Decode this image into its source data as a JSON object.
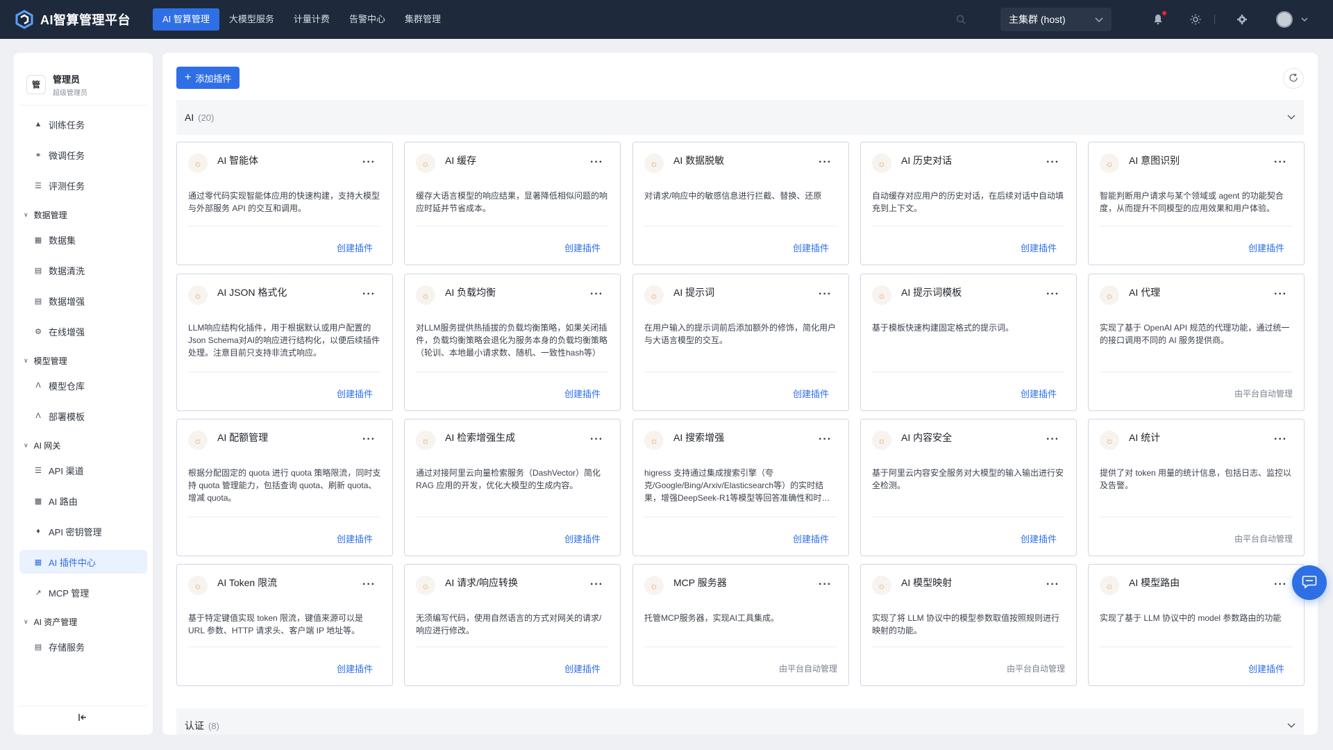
{
  "app": {
    "title": "AI智算管理平台"
  },
  "topnav": [
    {
      "label": "AI 智算管理",
      "active": true
    },
    {
      "label": "大模型服务",
      "active": false
    },
    {
      "label": "计量计费",
      "active": false
    },
    {
      "label": "告警中心",
      "active": false
    },
    {
      "label": "集群管理",
      "active": false
    }
  ],
  "cluster": {
    "selected": "主集群 (host)"
  },
  "user": {
    "avatar_text": "管",
    "name": "管理员",
    "role": "超级管理员"
  },
  "sidebar": {
    "top_items": [
      {
        "label": "训练任务",
        "icon": "training-icon"
      },
      {
        "label": "微调任务",
        "icon": "finetune-icon"
      },
      {
        "label": "评测任务",
        "icon": "evaluate-icon"
      }
    ],
    "groups": [
      {
        "label": "数据管理",
        "items": [
          {
            "label": "数据集",
            "icon": "dataset-icon"
          },
          {
            "label": "数据清洗",
            "icon": "clean-icon"
          },
          {
            "label": "数据增强",
            "icon": "augment-icon"
          },
          {
            "label": "在线增强",
            "icon": "online-augment-icon"
          }
        ]
      },
      {
        "label": "模型管理",
        "items": [
          {
            "label": "模型仓库",
            "icon": "model-repo-icon"
          },
          {
            "label": "部署模板",
            "icon": "deploy-template-icon"
          }
        ]
      },
      {
        "label": "AI 网关",
        "items": [
          {
            "label": "API 渠道",
            "icon": "api-channel-icon"
          },
          {
            "label": "AI 路由",
            "icon": "ai-route-icon"
          },
          {
            "label": "API 密钥管理",
            "icon": "key-icon"
          },
          {
            "label": "AI 插件中心",
            "icon": "plugin-icon",
            "active": true
          },
          {
            "label": "MCP 管理",
            "icon": "mcp-icon"
          }
        ]
      },
      {
        "label": "AI 资产管理",
        "items": [
          {
            "label": "存储服务",
            "icon": "storage-icon"
          }
        ]
      }
    ]
  },
  "main": {
    "add_button": "添加插件",
    "sections": [
      {
        "name": "AI",
        "count": "(20)"
      },
      {
        "name": "认证",
        "count": "(8)"
      }
    ],
    "create_label": "创建插件",
    "auto_label": "由平台自动管理",
    "plugins": [
      {
        "name": "AI 智能体",
        "desc": "通过零代码实现智能体应用的快速构建，支持大模型与外部服务 API 的交互和调用。",
        "auto": false
      },
      {
        "name": "AI 缓存",
        "desc": "缓存大语言模型的响应结果，显著降低相似问题的响应时延并节省成本。",
        "auto": false
      },
      {
        "name": "AI 数据脱敏",
        "desc": "对请求/响应中的敏感信息进行拦截、替换、还原",
        "auto": false
      },
      {
        "name": "AI 历史对话",
        "desc": "自动缓存对应用户的历史对话，在后续对话中自动填充到上下文。",
        "auto": false
      },
      {
        "name": "AI 意图识别",
        "desc": "智能判断用户请求与某个领域或 agent 的功能契合度，从而提升不同模型的应用效果和用户体验。",
        "auto": false
      },
      {
        "name": "AI JSON 格式化",
        "desc": "LLM响应结构化插件，用于根据默认或用户配置的Json Schema对AI的响应进行结构化，以便后续插件处理。注意目前只支持非流式响应。",
        "auto": false
      },
      {
        "name": "AI 负载均衡",
        "desc": "对LLM服务提供热插拔的负载均衡策略，如果关闭插件，负载均衡策略会退化为服务本身的负载均衡策略（轮训、本地最小请求数、随机、一致性hash等）",
        "auto": false
      },
      {
        "name": "AI 提示词",
        "desc": "在用户输入的提示词前后添加额外的修饰，简化用户与大语言模型的交互。",
        "auto": false
      },
      {
        "name": "AI 提示词模板",
        "desc": "基于模板快速构建固定格式的提示词。",
        "auto": false
      },
      {
        "name": "AI 代理",
        "desc": "实现了基于 OpenAI API 规范的代理功能，通过统一的接口调用不同的 AI 服务提供商。",
        "auto": true
      },
      {
        "name": "AI 配额管理",
        "desc": "根据分配固定的 quota 进行 quota 策略限流，同时支持 quota 管理能力，包括查询 quota、刷新 quota、增减 quota。",
        "auto": false
      },
      {
        "name": "AI 检索增强生成",
        "desc": "通过对接阿里云向量检索服务（DashVector）简化 RAG 应用的开发，优化大模型的生成内容。",
        "auto": false
      },
      {
        "name": "AI 搜索增强",
        "desc": "higress 支持通过集成搜索引擎（夸克/Google/Bing/Arxiv/Elasticsearch等）的实时结果，增强DeepSeek-R1等模型等回答准确性和时…",
        "auto": false
      },
      {
        "name": "AI 内容安全",
        "desc": "基于阿里云内容安全服务对大模型的输入输出进行安全检测。",
        "auto": false
      },
      {
        "name": "AI 统计",
        "desc": "提供了对 token 用量的统计信息，包括日志、监控以及告警。",
        "auto": true
      },
      {
        "name": "AI Token 限流",
        "desc": "基于特定键值实现 token 限流，键值来源可以是 URL 参数、HTTP 请求头、客户端 IP 地址等。",
        "auto": false
      },
      {
        "name": "AI 请求/响应转换",
        "desc": "无须编写代码，使用自然语言的方式对网关的请求/响应进行修改。",
        "auto": false
      },
      {
        "name": "MCP 服务器",
        "desc": "托管MCP服务器，实现AI工具集成。",
        "auto": true
      },
      {
        "name": "AI 模型映射",
        "desc": "实现了将 LLM 协议中的模型参数取值按照规则进行映射的功能。",
        "auto": true
      },
      {
        "name": "AI 模型路由",
        "desc": "实现了基于 LLM 协议中的 model 参数路由的功能",
        "auto": false
      }
    ]
  }
}
